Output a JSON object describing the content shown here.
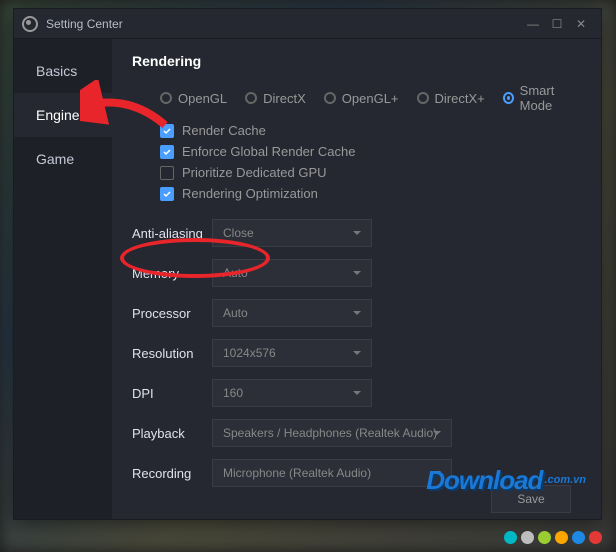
{
  "window": {
    "title": "Setting Center",
    "sidebar": {
      "items": [
        {
          "label": "Basics"
        },
        {
          "label": "Engine"
        },
        {
          "label": "Game"
        }
      ]
    },
    "section": {
      "title": "Rendering",
      "modes": {
        "opengl": "OpenGL",
        "directx": "DirectX",
        "openglplus": "OpenGL+",
        "directxplus": "DirectX+",
        "smart": "Smart Mode"
      },
      "checks": {
        "render_cache": "Render Cache",
        "enforce_global": "Enforce Global Render Cache",
        "prioritize_gpu": "Prioritize Dedicated GPU",
        "render_opt": "Rendering Optimization"
      },
      "rows": {
        "aa_label": "Anti-aliasing",
        "aa_value": "Close",
        "mem_label": "Memory",
        "mem_value": "Auto",
        "proc_label": "Processor",
        "proc_value": "Auto",
        "res_label": "Resolution",
        "res_value": "1024x576",
        "dpi_label": "DPI",
        "dpi_value": "160",
        "playback_label": "Playback",
        "playback_value": "Speakers / Headphones (Realtek Audio)",
        "rec_label": "Recording",
        "rec_value": "Microphone (Realtek Audio)"
      }
    },
    "save_label": "Save"
  },
  "watermark": {
    "main": "Download",
    "sub": ".com.vn"
  },
  "dot_colors": [
    "#00b8c4",
    "#bdbdbd",
    "#9acd32",
    "#ffa500",
    "#1e88e5",
    "#e53935"
  ]
}
